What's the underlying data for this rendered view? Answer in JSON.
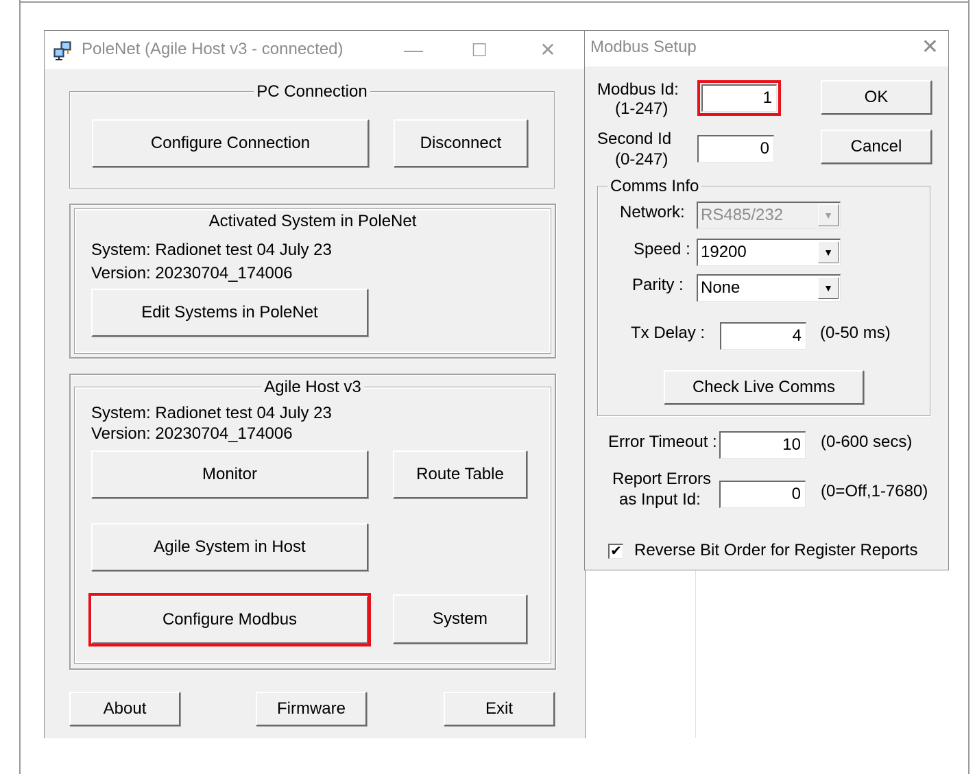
{
  "main_window": {
    "title": "PoleNet (Agile Host v3 - connected)",
    "minimize_glyph": "—",
    "maximize_glyph": "☐",
    "close_glyph": "✕",
    "pc_connection": {
      "title": "PC Connection",
      "configure_connection": "Configure Connection",
      "disconnect": "Disconnect"
    },
    "activated_system": {
      "title": "Activated System in PoleNet",
      "system": "System: Radionet test 04 July 23",
      "version": "Version: 20230704_174006",
      "edit_systems": "Edit Systems in PoleNet"
    },
    "agile_host": {
      "title": "Agile Host v3",
      "system": "System: Radionet test 04 July 23",
      "version": "Version: 20230704_174006",
      "monitor": "Monitor",
      "route_table": "Route Table",
      "agile_system_in_host": "Agile System in Host",
      "configure_modbus": "Configure Modbus",
      "system_button": "System"
    },
    "about": "About",
    "firmware": "Firmware",
    "exit": "Exit"
  },
  "modbus_dialog": {
    "title": "Modbus Setup",
    "close_glyph": "✕",
    "modbus_id_label_1": "Modbus Id:",
    "modbus_id_label_2": "(1-247)",
    "modbus_id_value": "1",
    "second_id_label_1": "Second Id",
    "second_id_label_2": "(0-247)",
    "second_id_value": "0",
    "ok": "OK",
    "cancel": "Cancel",
    "comms_info": {
      "title": "Comms Info",
      "network_label": "Network:",
      "network_value": "RS485/232",
      "speed_label": "Speed :",
      "speed_value": "19200",
      "parity_label": "Parity :",
      "parity_value": "None",
      "tx_delay_label": "Tx Delay :",
      "tx_delay_value": "4",
      "tx_delay_range": "(0-50 ms)",
      "check_live_comms": "Check Live Comms"
    },
    "error_timeout_label": "Error Timeout :",
    "error_timeout_value": "10",
    "error_timeout_range": "(0-600 secs)",
    "report_errors_label_1": "Report Errors",
    "report_errors_label_2": "as Input Id:",
    "report_errors_value": "0",
    "report_errors_range": "(0=Off,1-7680)",
    "reverse_bit_order_label": "Reverse Bit Order for Register Reports",
    "reverse_bit_order_checked": true,
    "check_glyph": "✔",
    "dropdown_glyph": "▼"
  },
  "colors": {
    "highlight": "#e8111a",
    "window_bg": "#f0f0f0",
    "title_text": "#8c8c8c"
  }
}
